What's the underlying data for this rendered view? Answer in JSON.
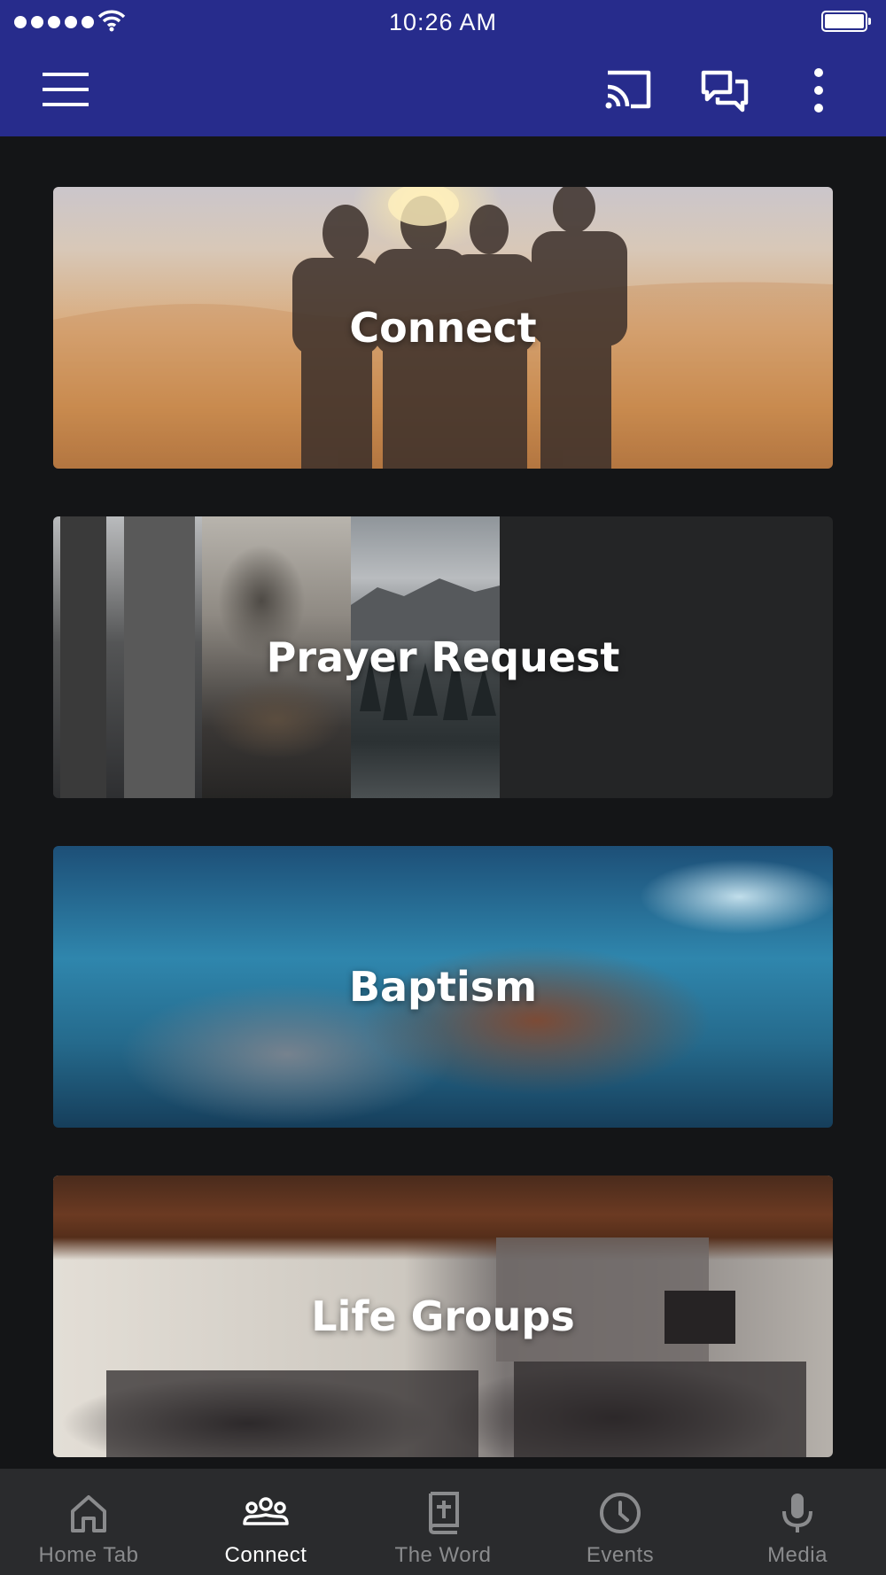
{
  "status_bar": {
    "time": "10:26 AM"
  },
  "cards": [
    {
      "title": "Connect"
    },
    {
      "title": "Prayer Request"
    },
    {
      "title": "Baptism"
    },
    {
      "title": "Life Groups"
    }
  ],
  "bottom_nav": {
    "items": [
      {
        "label": "Home Tab",
        "icon": "home-icon"
      },
      {
        "label": "Connect",
        "icon": "people-icon",
        "active": true
      },
      {
        "label": "The Word",
        "icon": "bible-icon"
      },
      {
        "label": "Events",
        "icon": "clock-icon"
      },
      {
        "label": "Media",
        "icon": "microphone-icon"
      }
    ]
  },
  "colors": {
    "app_bar": "#272c8c",
    "background": "#141517",
    "nav_background": "#2a2b2d",
    "nav_inactive": "#8a8b8d",
    "nav_active": "#ffffff"
  }
}
